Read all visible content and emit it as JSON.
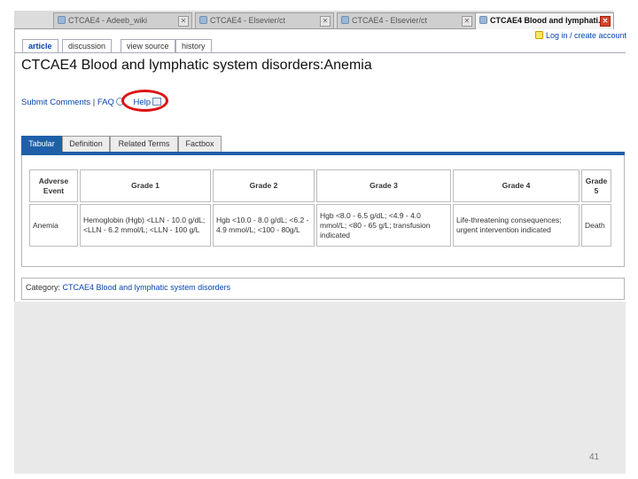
{
  "browser_tabs": [
    {
      "label": "CTCAE4 - Adeeb_wiki",
      "active": false
    },
    {
      "label": "CTCAE4 - Elsevier/ct",
      "active": false
    },
    {
      "label": "CTCAE4 - Elsevier/ct",
      "active": false
    },
    {
      "label": "CTCAE4 Blood and lymphati...",
      "active": true
    }
  ],
  "wiki_tabs": [
    {
      "label": "article",
      "selected": true
    },
    {
      "label": "discussion",
      "selected": false
    },
    {
      "label": "view source",
      "selected": false
    },
    {
      "label": "history",
      "selected": false
    }
  ],
  "login_text": "Log in / create account",
  "page_title": "CTCAE4 Blood and lymphatic system disorders:Anemia",
  "submit_bar": {
    "submit_label": "Submit Comments",
    "separator": "|",
    "faq_label": "FAQ",
    "help_label": "Help"
  },
  "content_tabs": [
    {
      "label": "Tabular",
      "selected": true
    },
    {
      "label": "Definition",
      "selected": false
    },
    {
      "label": "Related Terms",
      "selected": false
    },
    {
      "label": "Factbox",
      "selected": false
    }
  ],
  "table": {
    "headers": [
      "Adverse Event",
      "Grade 1",
      "Grade 2",
      "Grade 3",
      "Grade 4",
      "Grade 5"
    ],
    "rows": [
      [
        "Anemia",
        "Hemoglobin (Hgb) <LLN - 10.0 g/dL; <LLN - 6.2 mmol/L; <LLN - 100 g/L",
        "Hgb <10.0 - 8.0 g/dL; <6.2 - 4.9 mmol/L; <100 - 80g/L",
        "Hgb <8.0 - 6.5 g/dL; <4.9 - 4.0 mmol/L; <80 - 65 g/L; transfusion indicated",
        "Life-threatening consequences; urgent intervention indicated",
        "Death"
      ]
    ]
  },
  "category": {
    "label": "Category:",
    "link": "CTCAE4 Blood and lymphatic system disorders"
  },
  "slide_number": "41",
  "colors": {
    "accent": "#1f5fa8",
    "annotation_circle": "#dd1111",
    "link": "#0645ad"
  }
}
